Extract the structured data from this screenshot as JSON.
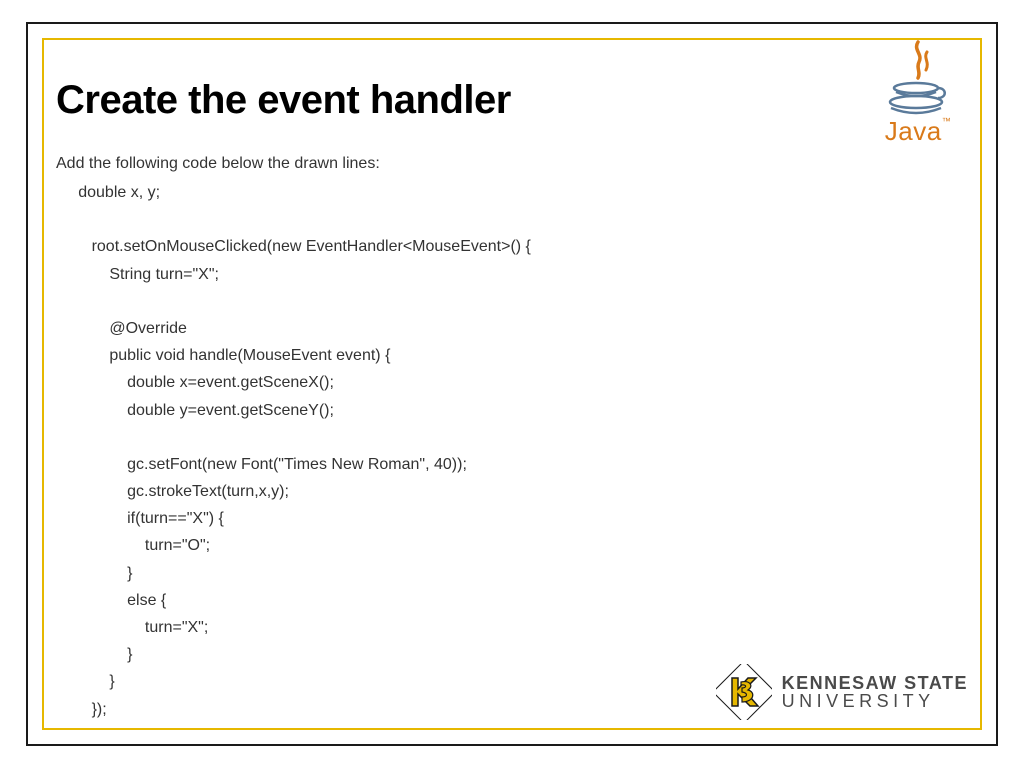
{
  "title": "Create the event handler",
  "subtitle": "Add the following code below the drawn lines:",
  "code": "     double x, y;\n\n        root.setOnMouseClicked(new EventHandler<MouseEvent>() {\n            String turn=\"X\";\n\n            @Override\n            public void handle(MouseEvent event) {\n                double x=event.getSceneX();\n                double y=event.getSceneY();\n\n                gc.setFont(new Font(\"Times New Roman\", 40));\n                gc.strokeText(turn,x,y);\n                if(turn==\"X\") {\n                    turn=\"O\";\n                }\n                else {\n                    turn=\"X\";\n                }\n            }\n        });",
  "java_logo_text": "Java",
  "ksu": {
    "line1": "KENNESAW STATE",
    "line2": "UNIVERSITY"
  }
}
